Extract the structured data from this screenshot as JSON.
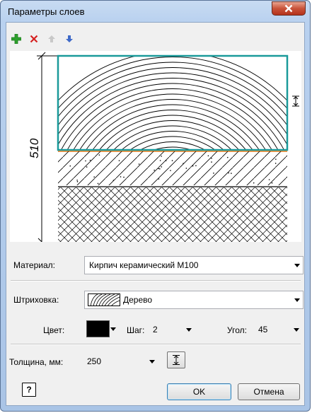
{
  "window": {
    "title": "Параметры слоев"
  },
  "toolbar": {
    "icons": [
      "add-icon",
      "delete-icon",
      "move-up-icon",
      "move-down-icon"
    ]
  },
  "preview": {
    "dimension_label": "510"
  },
  "material": {
    "label": "Материал:",
    "value": "Кирпич керамический М100"
  },
  "hatch": {
    "label": "Штриховка:",
    "value": "Дерево"
  },
  "color": {
    "label": "Цвет:",
    "value": "#000000"
  },
  "step": {
    "label": "Шаг:",
    "value": "2"
  },
  "angle": {
    "label": "Угол:",
    "value": "45"
  },
  "thickness": {
    "label": "Толщина, мм:",
    "value": "250"
  },
  "buttons": {
    "ok": "OK",
    "cancel": "Отмена"
  },
  "colors": {
    "highlight_border": "#1a9a9a",
    "boundary_line": "#e07b1c"
  }
}
